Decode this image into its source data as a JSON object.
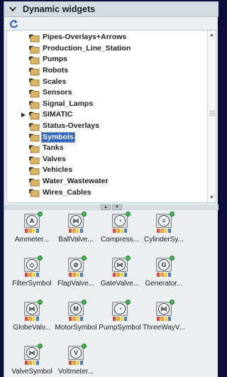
{
  "header": {
    "title": "Dynamic widgets"
  },
  "tree": {
    "items": [
      {
        "label": "Pipes-Overlays+Arrows"
      },
      {
        "label": "Production_Line_Station"
      },
      {
        "label": "Pumps"
      },
      {
        "label": "Robots"
      },
      {
        "label": "Scales"
      },
      {
        "label": "Sensors"
      },
      {
        "label": "Signal_Lamps"
      },
      {
        "label": "SIMATIC",
        "expandable": true
      },
      {
        "label": "Status-Overlays"
      },
      {
        "label": "Symbols",
        "selected": true
      },
      {
        "label": "Tanks"
      },
      {
        "label": "Valves"
      },
      {
        "label": "Vehicles"
      },
      {
        "label": "Water_Wastewater"
      },
      {
        "label": "Wires_Cables"
      }
    ]
  },
  "gallery": {
    "items": [
      {
        "label": "Ammeter...",
        "icon": "ammeter-icon",
        "glyph": "A"
      },
      {
        "label": "BallValve...",
        "icon": "ball-valve-icon",
        "glyph": "⋈"
      },
      {
        "label": "Compress...",
        "icon": "compressor-icon",
        "glyph": "◔"
      },
      {
        "label": "CylinderSy...",
        "icon": "cylinder-icon",
        "glyph": "≡"
      },
      {
        "label": "FilterSymbol",
        "icon": "filter-icon",
        "glyph": "◇"
      },
      {
        "label": "FlapValve...",
        "icon": "flap-valve-icon",
        "glyph": "⊘"
      },
      {
        "label": "GateValve...",
        "icon": "gate-valve-icon",
        "glyph": "⋈"
      },
      {
        "label": "Generator...",
        "icon": "generator-icon",
        "glyph": "G"
      },
      {
        "label": "GlobeValv...",
        "icon": "globe-valve-icon",
        "glyph": "⋈"
      },
      {
        "label": "MotorSymbol",
        "icon": "motor-icon",
        "glyph": "M"
      },
      {
        "label": "PumpSymbol",
        "icon": "pump-icon",
        "glyph": "◔"
      },
      {
        "label": "ThreeWayV...",
        "icon": "three-way-valve-icon",
        "glyph": "⋈"
      },
      {
        "label": "ValveSymbol",
        "icon": "valve-icon",
        "glyph": "⋈"
      },
      {
        "label": "Voltmeter...",
        "icon": "voltmeter-icon",
        "glyph": "V"
      }
    ]
  },
  "colors": {
    "selection": "#2e67c9",
    "status_dot": "#3fb54d",
    "strip": [
      "#e04a3a",
      "#e8a23a",
      "#f0d23a",
      "#4a7bd8"
    ]
  }
}
